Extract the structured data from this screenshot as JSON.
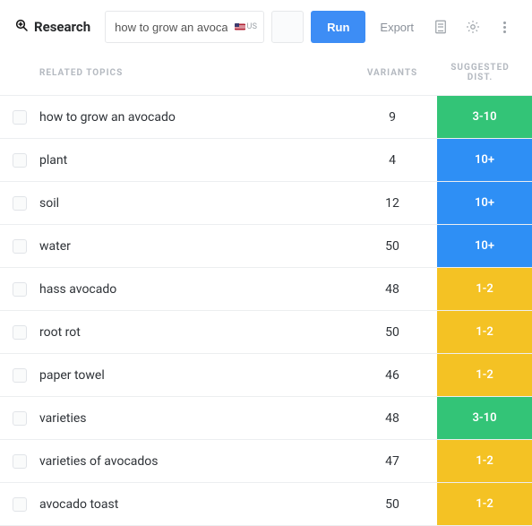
{
  "header": {
    "brand_label": "Research",
    "search_value": "how to grow an avocado",
    "locale_code": "US",
    "run_label": "Run",
    "export_label": "Export"
  },
  "columns": {
    "topic": "RELATED TOPICS",
    "variants": "VARIANTS",
    "dist": "SUGGESTED DIST."
  },
  "dist_colors": {
    "green": "#33c477",
    "blue": "#2e8ff5",
    "yellow": "#f4c224"
  },
  "rows": [
    {
      "topic": "how to grow an avocado",
      "variants": 9,
      "dist": "3-10",
      "dist_color": "green"
    },
    {
      "topic": "plant",
      "variants": 4,
      "dist": "10+",
      "dist_color": "blue"
    },
    {
      "topic": "soil",
      "variants": 12,
      "dist": "10+",
      "dist_color": "blue"
    },
    {
      "topic": "water",
      "variants": 50,
      "dist": "10+",
      "dist_color": "blue"
    },
    {
      "topic": "hass avocado",
      "variants": 48,
      "dist": "1-2",
      "dist_color": "yellow"
    },
    {
      "topic": "root rot",
      "variants": 50,
      "dist": "1-2",
      "dist_color": "yellow"
    },
    {
      "topic": "paper towel",
      "variants": 46,
      "dist": "1-2",
      "dist_color": "yellow"
    },
    {
      "topic": "varieties",
      "variants": 48,
      "dist": "3-10",
      "dist_color": "green"
    },
    {
      "topic": "varieties of avocados",
      "variants": 47,
      "dist": "1-2",
      "dist_color": "yellow"
    },
    {
      "topic": "avocado toast",
      "variants": 50,
      "dist": "1-2",
      "dist_color": "yellow"
    }
  ]
}
